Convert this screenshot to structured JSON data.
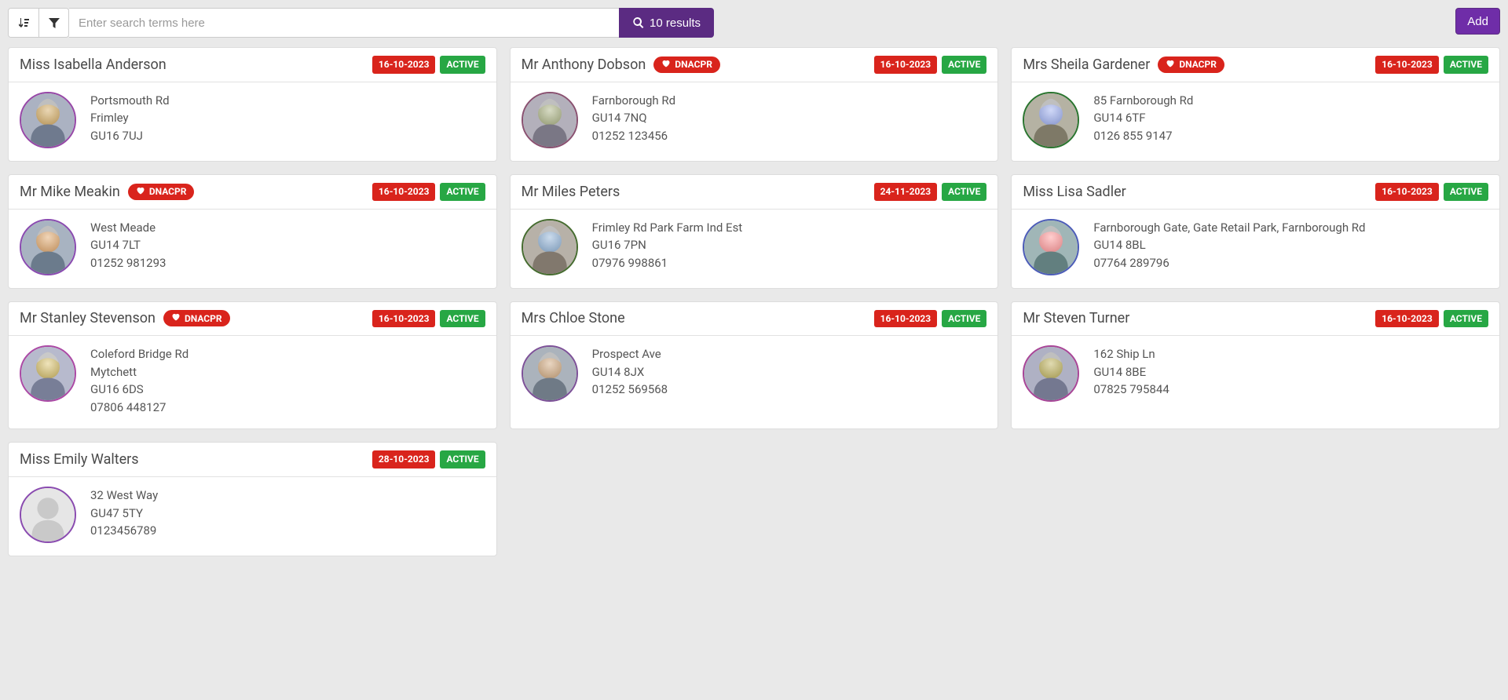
{
  "toolbar": {
    "search_placeholder": "Enter search terms here",
    "results_label": "10 results",
    "add_label": "Add"
  },
  "dnacpr_label": "DNACPR",
  "cards": [
    {
      "name": "Miss Isabella Anderson",
      "dnacpr": false,
      "date": "16-10-2023",
      "status": "ACTIVE",
      "lines": [
        "Portsmouth Rd",
        "Frimley",
        "GU16 7UJ"
      ],
      "avatar": "person"
    },
    {
      "name": "Mr Anthony Dobson",
      "dnacpr": true,
      "date": "16-10-2023",
      "status": "ACTIVE",
      "lines": [
        "Farnborough Rd",
        "GU14 7NQ",
        "01252 123456"
      ],
      "avatar": "person"
    },
    {
      "name": "Mrs Sheila Gardener",
      "dnacpr": true,
      "date": "16-10-2023",
      "status": "ACTIVE",
      "lines": [
        "85 Farnborough Rd",
        "GU14 6TF",
        "0126 855 9147"
      ],
      "avatar": "person"
    },
    {
      "name": "Mr Mike Meakin",
      "dnacpr": true,
      "date": "16-10-2023",
      "status": "ACTIVE",
      "lines": [
        "West Meade",
        "GU14 7LT",
        "01252 981293"
      ],
      "avatar": "person"
    },
    {
      "name": "Mr Miles Peters",
      "dnacpr": false,
      "date": "24-11-2023",
      "status": "ACTIVE",
      "lines": [
        "Frimley Rd Park Farm Ind Est",
        "GU16 7PN",
        "07976 998861"
      ],
      "avatar": "person"
    },
    {
      "name": "Miss Lisa Sadler",
      "dnacpr": false,
      "date": "16-10-2023",
      "status": "ACTIVE",
      "lines": [
        "Farnborough Gate, Gate Retail Park, Farnborough Rd",
        "GU14 8BL",
        "07764 289796"
      ],
      "avatar": "person"
    },
    {
      "name": "Mr Stanley Stevenson",
      "dnacpr": true,
      "date": "16-10-2023",
      "status": "ACTIVE",
      "lines": [
        "Coleford Bridge Rd",
        "Mytchett",
        "GU16 6DS",
        "07806 448127"
      ],
      "avatar": "person"
    },
    {
      "name": "Mrs Chloe Stone",
      "dnacpr": false,
      "date": "16-10-2023",
      "status": "ACTIVE",
      "lines": [
        "Prospect Ave",
        "GU14 8JX",
        "01252 569568"
      ],
      "avatar": "person"
    },
    {
      "name": "Mr Steven Turner",
      "dnacpr": false,
      "date": "16-10-2023",
      "status": "ACTIVE",
      "lines": [
        "162 Ship Ln",
        "GU14 8BE",
        "07825 795844"
      ],
      "avatar": "person"
    },
    {
      "name": "Miss Emily Walters",
      "dnacpr": false,
      "date": "28-10-2023",
      "status": "ACTIVE",
      "lines": [
        "32 West Way",
        "GU47 5TY",
        "0123456789"
      ],
      "avatar": "placeholder"
    }
  ]
}
